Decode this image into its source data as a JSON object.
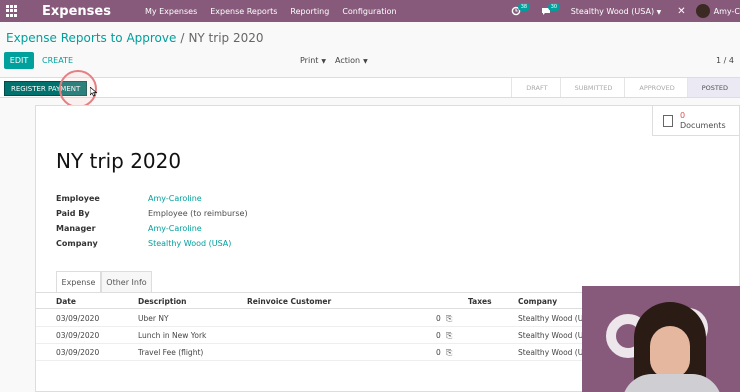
{
  "navbar": {
    "app_title": "Expenses",
    "menu": [
      "My Expenses",
      "Expense Reports",
      "Reporting",
      "Configuration"
    ],
    "activity_count": "38",
    "message_count": "30",
    "company": "Stealthy Wood (USA)",
    "user": "Amy-C",
    "colors": {
      "brand": "#875a7b",
      "accent": "#00a09d"
    }
  },
  "control": {
    "breadcrumb_parent": "Expense Reports to Approve",
    "breadcrumb_sep": "/",
    "breadcrumb_current": "NY trip 2020",
    "edit_label": "EDIT",
    "create_label": "CREATE",
    "print_label": "Print",
    "action_label": "Action",
    "pager": "1 / 4"
  },
  "statusbar": {
    "register_label": "REGISTER PAYMENT",
    "stages": [
      "DRAFT",
      "SUBMITTED",
      "APPROVED",
      "POSTED"
    ],
    "active_stage": "POSTED"
  },
  "sheet": {
    "documents_count": "0",
    "documents_label": "Documents",
    "title": "NY trip 2020",
    "fields": [
      {
        "label": "Employee",
        "value": "Amy-Caroline",
        "link": true
      },
      {
        "label": "Paid By",
        "value": "Employee (to reimburse)",
        "link": false
      },
      {
        "label": "Manager",
        "value": "Amy-Caroline",
        "link": true
      },
      {
        "label": "Company",
        "value": "Stealthy Wood (USA)",
        "link": true
      }
    ],
    "tabs": [
      "Expense",
      "Other Info"
    ],
    "table": {
      "headers": [
        "Date",
        "Description",
        "Reinvoice Customer",
        "Taxes",
        "Company"
      ],
      "rows": [
        [
          "03/09/2020",
          "Uber NY",
          "0",
          "Stealthy Wood (US"
        ],
        [
          "03/09/2020",
          "Lunch in New York",
          "0",
          "Stealthy Wood (US"
        ],
        [
          "03/09/2020",
          "Travel Fee (flight)",
          "0",
          "Stealthy Wood (US"
        ]
      ]
    }
  },
  "icons": [
    "apps-grid-icon",
    "activity-icon",
    "chat-icon",
    "caret-down-icon",
    "close-icon",
    "document-icon",
    "paperclip-icon",
    "cursor-icon"
  ]
}
